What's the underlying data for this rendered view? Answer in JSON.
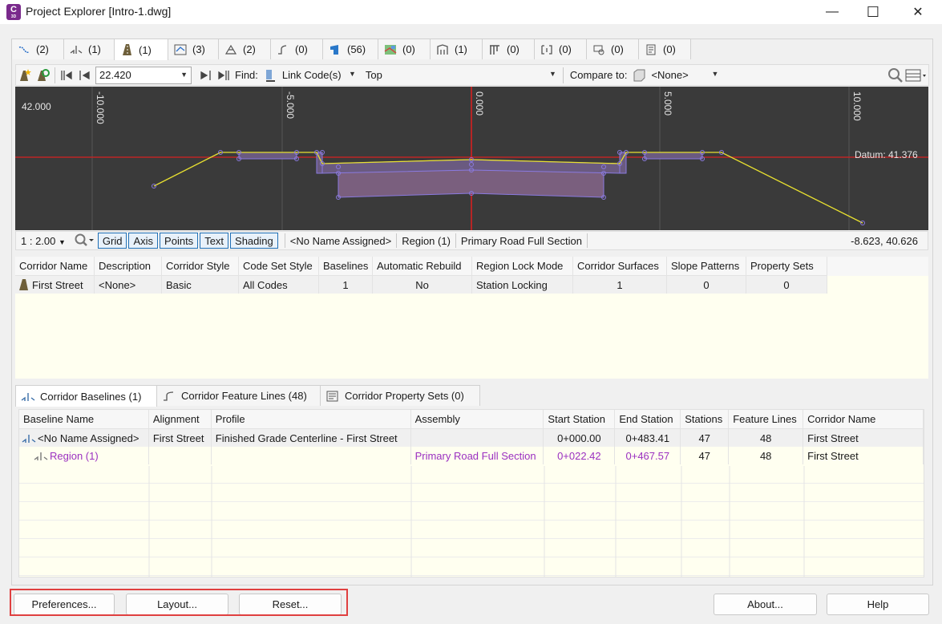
{
  "window": {
    "title": "Project Explorer [Intro-1.dwg]",
    "app_icon_letter": "C",
    "app_icon_sub": "3D",
    "minimize_glyph": "—",
    "maximize_glyph": "☐",
    "close_glyph": "✕"
  },
  "top_tabs": [
    {
      "count": "(2)",
      "icon": "alignment-icon"
    },
    {
      "count": "(1)",
      "icon": "assembly-icon"
    },
    {
      "count": "(1)",
      "icon": "corridor-icon"
    },
    {
      "count": "(3)",
      "icon": "profile-icon"
    },
    {
      "count": "(2)",
      "icon": "surface-icon"
    },
    {
      "count": "(0)",
      "icon": "feature-line-icon"
    },
    {
      "count": "(56)",
      "icon": "parcel-icon"
    },
    {
      "count": "(0)",
      "icon": "map-icon"
    },
    {
      "count": "(1)",
      "icon": "sample-line-icon"
    },
    {
      "count": "(0)",
      "icon": "pipe-network-icon"
    },
    {
      "count": "(0)",
      "icon": "section-view-icon"
    },
    {
      "count": "(0)",
      "icon": "label-icon"
    },
    {
      "count": "(0)",
      "icon": "data-shortcut-icon"
    }
  ],
  "toolbar": {
    "station_value": "22.420",
    "find_label": "Find:",
    "find_mode": "Link Code(s)",
    "find_value": "Top",
    "compare_label": "Compare to:",
    "compare_value": "<None>"
  },
  "viewer": {
    "background": "#3a3a3a",
    "y_label": "42.000",
    "x_ticks": [
      "-10.000",
      "-5.000",
      "0.000",
      "5.000",
      "10.000"
    ],
    "datum_label": "Datum: 41.376"
  },
  "viewer_status": {
    "scale": "1 : 2.00",
    "toggles": [
      "Grid",
      "Axis",
      "Points",
      "Text",
      "Shading"
    ],
    "baseline": "<No Name Assigned>",
    "region": "Region (1)",
    "assembly": "Primary Road Full Section",
    "coords": "-8.623, 40.626"
  },
  "corridor_table": {
    "headers": [
      "Corridor Name",
      "Description",
      "Corridor Style",
      "Code Set Style",
      "Baselines",
      "Automatic Rebuild",
      "Region Lock Mode",
      "Corridor Surfaces",
      "Slope Patterns",
      "Property Sets"
    ],
    "rows": [
      [
        "First Street",
        "<None>",
        "Basic",
        "All Codes",
        "1",
        "No",
        "Station Locking",
        "1",
        "0",
        "0"
      ]
    ]
  },
  "bottom_tabs": [
    {
      "label": "Corridor Baselines (1)",
      "icon": "baseline-icon"
    },
    {
      "label": "Corridor Feature Lines (48)",
      "icon": "feature-line-icon"
    },
    {
      "label": "Corridor Property Sets (0)",
      "icon": "property-set-icon"
    }
  ],
  "baseline_table": {
    "headers": [
      "Baseline Name",
      "Alignment",
      "Profile",
      "Assembly",
      "Start Station",
      "End Station",
      "Stations",
      "Feature Lines",
      "Corridor Name"
    ],
    "rows": [
      [
        "<No Name Assigned>",
        "First Street",
        "Finished Grade Centerline - First Street",
        "",
        "0+000.00",
        "0+483.41",
        "47",
        "48",
        "First Street"
      ],
      [
        "Region (1)",
        "",
        "",
        "Primary Road Full Section",
        "0+022.42",
        "0+467.57",
        "47",
        "48",
        "First Street"
      ]
    ],
    "region_color": "#9b30c0"
  },
  "buttons": {
    "preferences": "Preferences...",
    "layout": "Layout...",
    "reset": "Reset...",
    "about": "About...",
    "help": "Help"
  }
}
